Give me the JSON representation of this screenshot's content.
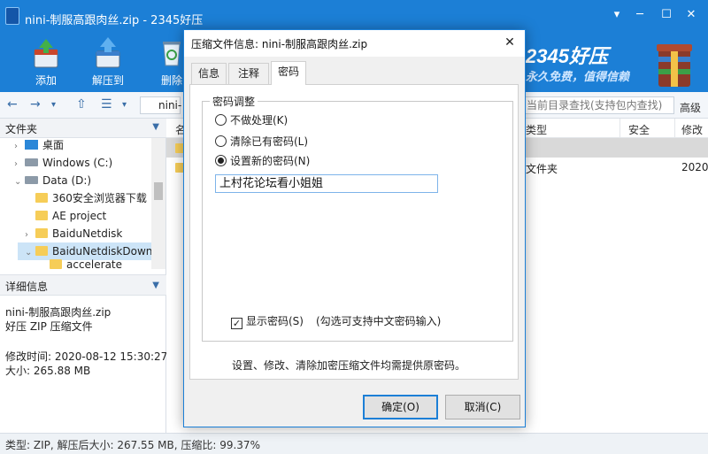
{
  "window": {
    "title": "nini-制服高跟肉丝.zip - 2345好压",
    "brand_name": "2345好压",
    "brand_slogan": "永久免费，值得信赖"
  },
  "toolbar": {
    "add_label": "添加",
    "extract_label": "解压到",
    "delete_label": "删除"
  },
  "address": {
    "path_text": "nini-",
    "search_placeholder": "当前目录查找(支持包内查找)",
    "advanced_label": "高级"
  },
  "sidebar": {
    "header": "文件夹",
    "items": [
      {
        "label": "桌面",
        "icon": "desktop-icon"
      },
      {
        "label": "Windows (C:)",
        "icon": "drive-icon"
      },
      {
        "label": "Data (D:)",
        "icon": "drive-icon"
      },
      {
        "label": "360安全浏览器下载",
        "icon": "folder-icon"
      },
      {
        "label": "AE project",
        "icon": "folder-icon"
      },
      {
        "label": "BaiduNetdisk",
        "icon": "folder-icon"
      },
      {
        "label": "BaiduNetdiskDownl",
        "icon": "folder-icon"
      },
      {
        "label": "accelerate",
        "icon": "folder-icon"
      }
    ]
  },
  "details": {
    "header": "详细信息",
    "filename": "nini-制服高跟肉丝.zip",
    "filetype": "好压 ZIP 压缩文件",
    "modified": "修改时间: 2020-08-12 15:30:27",
    "size": "大小: 265.88 MB"
  },
  "filelist": {
    "col_name": "名",
    "col_type": "类型",
    "col_security": "安全",
    "col_modified": "修改",
    "row_type": "文件夹",
    "row_modified": "2020-"
  },
  "statusbar": {
    "text": "类型: ZIP, 解压后大小: 267.55 MB, 压缩比: 99.37%"
  },
  "dialog": {
    "title": "压缩文件信息: nini-制服高跟肉丝.zip",
    "tabs": [
      "信息",
      "注释",
      "密码"
    ],
    "active_tab": "密码",
    "group_label": "密码调整",
    "radio_no_action": "不做处理(K)",
    "radio_clear": "清除已有密码(L)",
    "radio_set_new": "设置新的密码(N)",
    "selected_option": "设置新的密码(N)",
    "password_value": "上村花论坛看小姐姐",
    "show_password_label": "显示密码(S)",
    "show_password_checked": true,
    "show_password_note": "(勾选可支持中文密码输入)",
    "bottom_note": "设置、修改、清除加密压缩文件均需提供原密码。",
    "ok_label": "确定(O)",
    "cancel_label": "取消(C)"
  },
  "colors": {
    "accent": "#1c7fd6",
    "selection": "#cce4f7",
    "folder": "#f6cd58"
  }
}
